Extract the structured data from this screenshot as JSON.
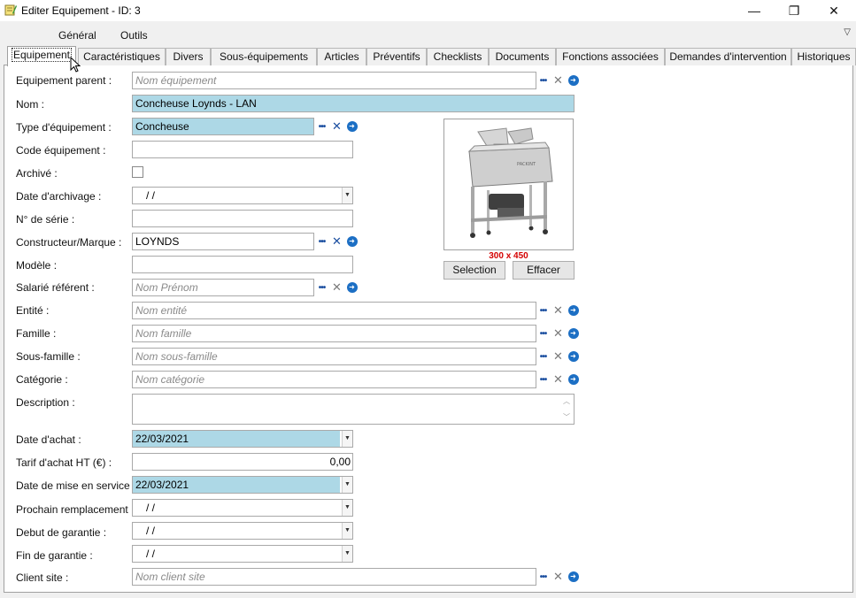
{
  "window": {
    "title": "Editer Equipement - ID: 3",
    "minimize_glyph": "—",
    "restore_glyph": "❐",
    "close_glyph": "✕"
  },
  "menu": {
    "items": [
      "Général",
      "Outils"
    ],
    "chevron": "▽"
  },
  "tabs": [
    "Equipement",
    "Caractéristiques",
    "Divers",
    "Sous-équipements",
    "Articles",
    "Préventifs",
    "Checklists",
    "Documents",
    "Fonctions associées",
    "Demandes d'intervention",
    "Historiques"
  ],
  "icons": {
    "more": "•••",
    "clear": "✕",
    "go": "➜",
    "dropdown": "▼",
    "scroll_up": "︿",
    "scroll_down": "﹀"
  },
  "form": {
    "parent": {
      "label": "Equipement parent :",
      "placeholder": "Nom équipement"
    },
    "nom": {
      "label": "Nom :",
      "value": "Concheuse Loynds - LAN"
    },
    "type": {
      "label": "Type d'équipement :",
      "value": "Concheuse"
    },
    "code": {
      "label": "Code équipement :",
      "value": ""
    },
    "archive": {
      "label": "Archivé :",
      "checked": false
    },
    "date_archivage": {
      "label": "Date d'archivage :",
      "value": "  /    /"
    },
    "serie": {
      "label": "N° de série :",
      "value": ""
    },
    "constructeur": {
      "label": "Constructeur/Marque :",
      "value": "LOYNDS"
    },
    "modele": {
      "label": "Modèle :",
      "value": ""
    },
    "salarie": {
      "label": "Salarié référent :",
      "placeholder": "Nom Prénom"
    },
    "entite": {
      "label": "Entité :",
      "placeholder": "Nom entité"
    },
    "famille": {
      "label": "Famille :",
      "placeholder": "Nom famille"
    },
    "sous_famille": {
      "label": "Sous-famille :",
      "placeholder": "Nom sous-famille"
    },
    "categorie": {
      "label": "Catégorie :",
      "placeholder": "Nom catégorie"
    },
    "description": {
      "label": "Description :",
      "value": ""
    },
    "date_achat": {
      "label": "Date d'achat :",
      "value": "22/03/2021"
    },
    "tarif": {
      "label": "Tarif d'achat HT (€) :",
      "value": "0,00"
    },
    "mise_service": {
      "label": "Date de mise en service :",
      "value": "22/03/2021"
    },
    "prochain": {
      "label": "Prochain remplacement :",
      "value": "  /    /"
    },
    "debut_garantie": {
      "label": "Debut de garantie :",
      "value": "  /    /"
    },
    "fin_garantie": {
      "label": "Fin de garantie :",
      "value": "  /    /"
    },
    "client_site": {
      "label": "Client site :",
      "placeholder": "Nom client site"
    }
  },
  "image": {
    "size_label": "300 x 450",
    "select_label": "Selection",
    "clear_label": "Effacer",
    "brand_text": "PACKINT"
  },
  "colors": {
    "highlight": "#add8e6",
    "accent_blue": "#1c4fa0",
    "size_red": "#d40000"
  }
}
